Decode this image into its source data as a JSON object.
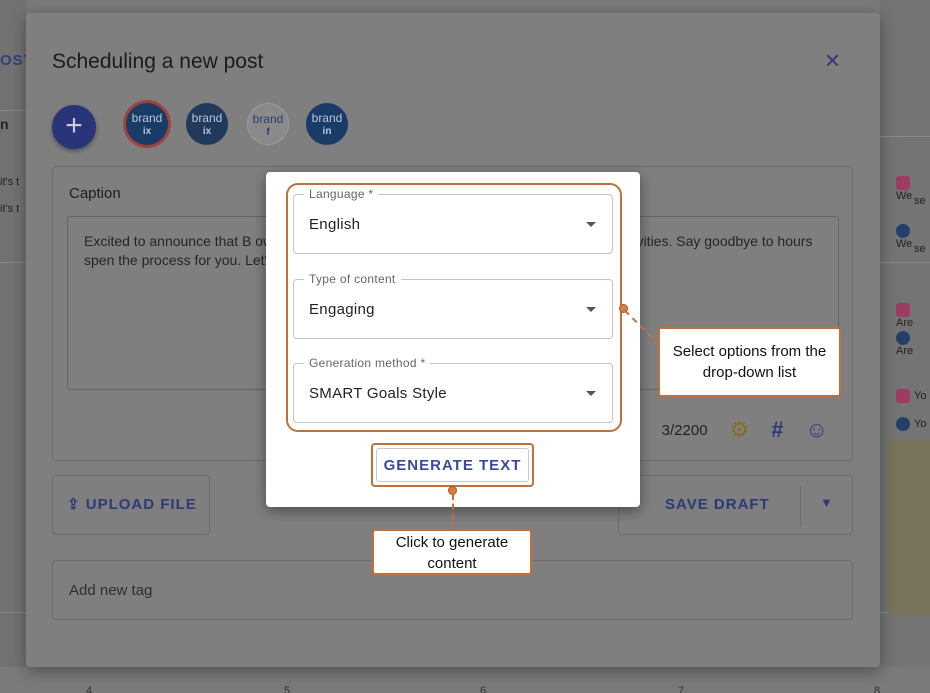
{
  "background": {
    "left_tab": "OST",
    "left_col_head": "n",
    "left_frags": [
      "it's t",
      "it's t"
    ],
    "right_entries": [
      {
        "type": "ig",
        "text": "We"
      },
      {
        "type": "ig",
        "text": "se"
      },
      {
        "type": "li",
        "text": "We"
      },
      {
        "type": "li",
        "text": "se"
      },
      {
        "type": "ig",
        "text": "Are"
      },
      {
        "type": "li",
        "text": "Are"
      },
      {
        "type": "ig",
        "text": "Yo"
      },
      {
        "type": "li",
        "text": "Yo"
      }
    ],
    "bottom_numbers": [
      "4",
      "5",
      "6",
      "7",
      "8"
    ]
  },
  "dialog": {
    "title": "Scheduling a new post",
    "close_icon": "×",
    "add_icon": "+",
    "brands": [
      {
        "name": "brand",
        "sub": "ix",
        "network": "instagram"
      },
      {
        "name": "brand",
        "sub": "ix",
        "network": "tiktok"
      },
      {
        "name": "brand",
        "sub": "f",
        "network": "facebook"
      },
      {
        "name": "brand",
        "sub": "in",
        "network": "linkedin"
      }
    ],
    "caption_label": "Caption",
    "caption_text": "Excited to announce that B                                                                owered content generation! Create high-qu                                                             her marketing activities. Say goodbye to hours spen                                                         the process for you. Let's make content creation effic",
    "char_count": "3/2200",
    "upload_label": "UPLOAD FILE",
    "upload_icon": "⇪",
    "save_draft_label": "SAVE DRAFT",
    "save_draft_caret": "▼",
    "tag_placeholder": "Add new tag"
  },
  "popup": {
    "fields": [
      {
        "label": "Language *",
        "value": "English"
      },
      {
        "label": "Type of content",
        "value": "Engaging"
      },
      {
        "label": "Generation method *",
        "value": "SMART Goals Style"
      }
    ],
    "generate_label": "GENERATE TEXT"
  },
  "callouts": {
    "select": "Select options from the drop-down list",
    "generate": "Click to generate content"
  },
  "colors": {
    "accent": "#3c47a0",
    "annotation": "#c0703a"
  }
}
